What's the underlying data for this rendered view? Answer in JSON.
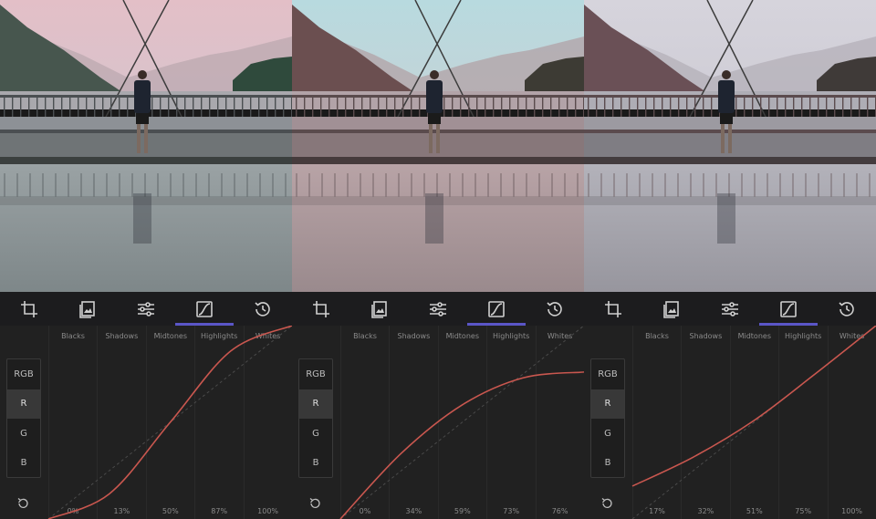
{
  "colors": {
    "accent": "#5a56c7",
    "curve": "#c9574f",
    "icon": "#cfcfcf"
  },
  "toolbar": {
    "tools": [
      {
        "name": "crop-icon"
      },
      {
        "name": "presets-icon"
      },
      {
        "name": "adjust-sliders-icon"
      },
      {
        "name": "curves-icon"
      },
      {
        "name": "history-icon"
      }
    ],
    "active_index": 3
  },
  "zones": [
    "Blacks",
    "Shadows",
    "Midtones",
    "Highlights",
    "Whites"
  ],
  "channels": [
    "RGB",
    "R",
    "G",
    "B"
  ],
  "panels": [
    {
      "tint": "pink",
      "selected_channel": "R",
      "percentages": [
        "0%",
        "13%",
        "50%",
        "87%",
        "100%"
      ],
      "curve_points": [
        [
          0,
          0
        ],
        [
          0.25,
          0.13
        ],
        [
          0.5,
          0.5
        ],
        [
          0.75,
          0.87
        ],
        [
          1,
          1
        ]
      ]
    },
    {
      "tint": "teal",
      "selected_channel": "R",
      "percentages": [
        "0%",
        "34%",
        "59%",
        "73%",
        "76%"
      ],
      "curve_points": [
        [
          0,
          0
        ],
        [
          0.25,
          0.34
        ],
        [
          0.5,
          0.59
        ],
        [
          0.75,
          0.73
        ],
        [
          1,
          0.76
        ]
      ]
    },
    {
      "tint": "gray",
      "selected_channel": "R",
      "percentages": [
        "17%",
        "32%",
        "51%",
        "75%",
        "100%"
      ],
      "curve_points": [
        [
          0,
          0.17
        ],
        [
          0.25,
          0.32
        ],
        [
          0.5,
          0.51
        ],
        [
          0.75,
          0.75
        ],
        [
          1,
          1
        ]
      ]
    }
  ]
}
